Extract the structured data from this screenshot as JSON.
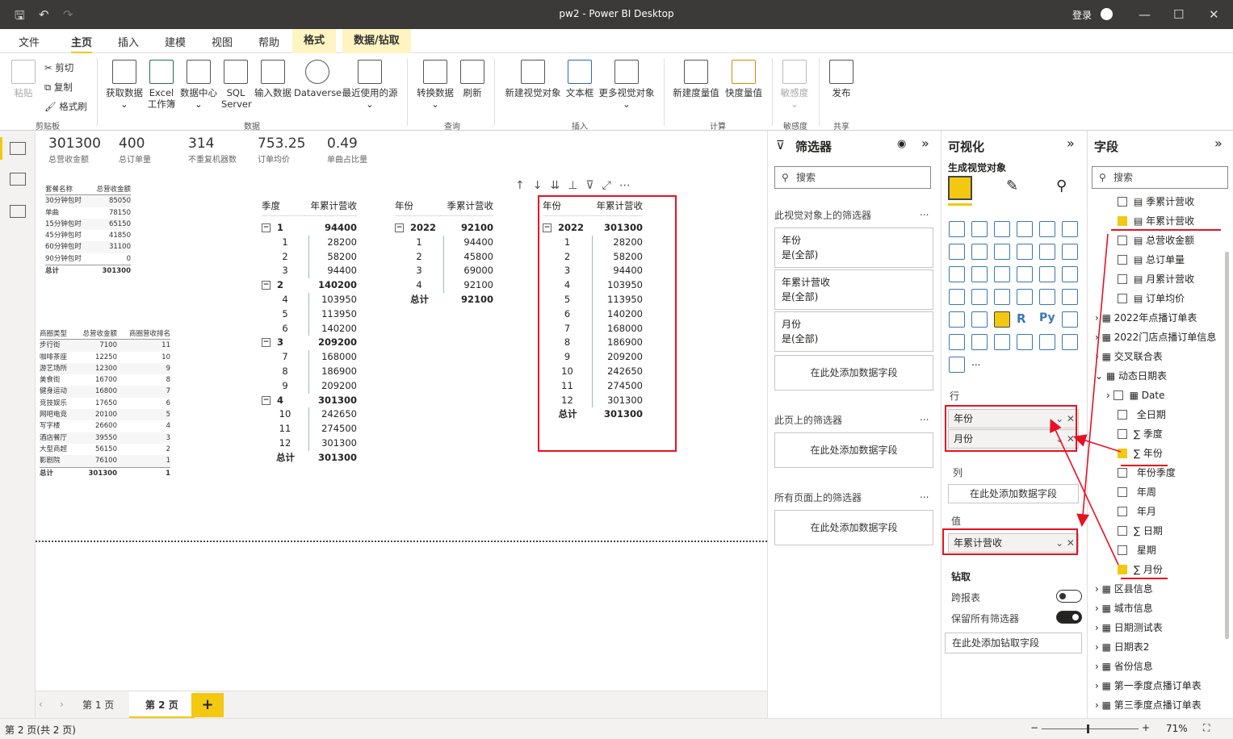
{
  "window": {
    "title": "pw2 - Power BI Desktop",
    "login": "登录"
  },
  "menu": [
    "文件",
    "主页",
    "插入",
    "建模",
    "视图",
    "帮助",
    "格式",
    "数据/钻取"
  ],
  "ribbon": {
    "clipboard": {
      "paste": "粘贴",
      "cut": "剪切",
      "copy": "复制",
      "format_painter": "格式刷",
      "group": "剪贴板"
    },
    "data": {
      "get_data": "获取数据",
      "excel": "Excel 工作簿",
      "datahub": "数据中心",
      "sql": "SQL Server",
      "enter": "输入数据",
      "dataverse": "Dataverse",
      "recent": "最近使用的源",
      "group": "数据"
    },
    "query": {
      "transform": "转换数据",
      "refresh": "刷新",
      "group": "查询"
    },
    "insert": {
      "new_visual": "新建视觉对象",
      "textbox": "文本框",
      "more_visuals": "更多视觉对象",
      "group": "插入"
    },
    "calc": {
      "new_measure": "新建度量值",
      "quick_measure": "快度量值",
      "group": "计算"
    },
    "sensitivity": {
      "label": "敏感度",
      "group": "敏感度"
    },
    "share": {
      "publish": "发布",
      "group": "共享"
    }
  },
  "kpis": [
    {
      "v": "301300",
      "l": "总营收金额"
    },
    {
      "v": "400",
      "l": "总订单量"
    },
    {
      "v": "314",
      "l": "不重复机器数"
    },
    {
      "v": "753.25",
      "l": "订单均价"
    },
    {
      "v": "0.49",
      "l": "单曲占比量"
    }
  ],
  "package_table": {
    "headers": [
      "套餐名称",
      "总营收金额"
    ],
    "rows": [
      [
        "30分钟包时",
        "85050"
      ],
      [
        "单曲",
        "78150"
      ],
      [
        "15分钟包时",
        "65150"
      ],
      [
        "45分钟包时",
        "41850"
      ],
      [
        "60分钟包时",
        "31100"
      ],
      [
        "90分钟包时",
        "0"
      ]
    ],
    "total": [
      "总计",
      "301300"
    ]
  },
  "business_table": {
    "headers": [
      "商圈类型",
      "总营收金额",
      "商圈营收排名"
    ],
    "rows": [
      [
        "步行街",
        "7100",
        "11"
      ],
      [
        "咖啡茶座",
        "12250",
        "10"
      ],
      [
        "游艺场所",
        "12300",
        "9"
      ],
      [
        "美食街",
        "16700",
        "8"
      ],
      [
        "健身运动",
        "16800",
        "7"
      ],
      [
        "竞技娱乐",
        "17650",
        "6"
      ],
      [
        "网吧电竞",
        "20100",
        "5"
      ],
      [
        "写字楼",
        "26600",
        "4"
      ],
      [
        "酒店餐厅",
        "39550",
        "3"
      ],
      [
        "大型商超",
        "56150",
        "2"
      ],
      [
        "影剧院",
        "76100",
        "1"
      ]
    ],
    "total": [
      "总计",
      "301300",
      "1"
    ]
  },
  "quarter_matrix": {
    "headers": [
      "季度",
      "年累计营收"
    ],
    "rows": [
      {
        "k": "1",
        "v": "94400",
        "lvl": 0
      },
      {
        "k": "1",
        "v": "28200",
        "lvl": 1
      },
      {
        "k": "2",
        "v": "58200",
        "lvl": 1
      },
      {
        "k": "3",
        "v": "94400",
        "lvl": 1
      },
      {
        "k": "2",
        "v": "140200",
        "lvl": 0
      },
      {
        "k": "4",
        "v": "103950",
        "lvl": 1
      },
      {
        "k": "5",
        "v": "113950",
        "lvl": 1
      },
      {
        "k": "6",
        "v": "140200",
        "lvl": 1
      },
      {
        "k": "3",
        "v": "209200",
        "lvl": 0
      },
      {
        "k": "7",
        "v": "168000",
        "lvl": 1
      },
      {
        "k": "8",
        "v": "186900",
        "lvl": 1
      },
      {
        "k": "9",
        "v": "209200",
        "lvl": 1
      },
      {
        "k": "4",
        "v": "301300",
        "lvl": 0
      },
      {
        "k": "10",
        "v": "242650",
        "lvl": 1
      },
      {
        "k": "11",
        "v": "274500",
        "lvl": 1
      },
      {
        "k": "12",
        "v": "301300",
        "lvl": 1
      },
      {
        "k": "总计",
        "v": "301300",
        "lvl": 2
      }
    ]
  },
  "year_quarter_matrix": {
    "headers": [
      "年份",
      "季累计营收"
    ],
    "rows": [
      {
        "k": "2022",
        "v": "92100",
        "lvl": 0
      },
      {
        "k": "1",
        "v": "94400",
        "lvl": 1
      },
      {
        "k": "2",
        "v": "45800",
        "lvl": 1
      },
      {
        "k": "3",
        "v": "69000",
        "lvl": 1
      },
      {
        "k": "4",
        "v": "92100",
        "lvl": 1
      },
      {
        "k": "总计",
        "v": "92100",
        "lvl": 2
      }
    ]
  },
  "year_month_matrix": {
    "headers": [
      "年份",
      "年累计营收"
    ],
    "rows": [
      {
        "k": "2022",
        "v": "301300",
        "lvl": 0
      },
      {
        "k": "1",
        "v": "28200",
        "lvl": 1
      },
      {
        "k": "2",
        "v": "58200",
        "lvl": 1
      },
      {
        "k": "3",
        "v": "94400",
        "lvl": 1
      },
      {
        "k": "4",
        "v": "103950",
        "lvl": 1
      },
      {
        "k": "5",
        "v": "113950",
        "lvl": 1
      },
      {
        "k": "6",
        "v": "140200",
        "lvl": 1
      },
      {
        "k": "7",
        "v": "168000",
        "lvl": 1
      },
      {
        "k": "8",
        "v": "186900",
        "lvl": 1
      },
      {
        "k": "9",
        "v": "209200",
        "lvl": 1
      },
      {
        "k": "10",
        "v": "242650",
        "lvl": 1
      },
      {
        "k": "11",
        "v": "274500",
        "lvl": 1
      },
      {
        "k": "12",
        "v": "301300",
        "lvl": 1
      },
      {
        "k": "总计",
        "v": "301300",
        "lvl": 2
      }
    ]
  },
  "pages": {
    "tabs": [
      "第 1 页",
      "第 2 页"
    ],
    "active": 1,
    "add": "+"
  },
  "status": {
    "page": "第 2 页(共 2 页)",
    "zoom": "71%"
  },
  "filters": {
    "title": "筛选器",
    "search": "搜索",
    "visual_section": "此视觉对象上的筛选器",
    "cards": [
      {
        "name": "年份",
        "value": "是(全部)"
      },
      {
        "name": "年累计营收",
        "value": "是(全部)"
      },
      {
        "name": "月份",
        "value": "是(全部)"
      }
    ],
    "add": "在此处添加数据字段",
    "page_section": "此页上的筛选器",
    "all_section": "所有页面上的筛选器",
    "more": "..."
  },
  "viz": {
    "title": "可视化",
    "subtitle": "生成视觉对象",
    "rows_label": "行",
    "rows": [
      "年份",
      "月份"
    ],
    "cols_label": "列",
    "cols_add": "在此处添加数据字段",
    "values_label": "值",
    "values": [
      "年累计营收"
    ],
    "drill": "钻取",
    "cross_report": "跨报表",
    "keep_filters": "保留所有筛选器",
    "drill_add": "在此处添加钻取字段",
    "r": "R",
    "py": "Py",
    "more": "..."
  },
  "fields": {
    "title": "字段",
    "search": "搜索",
    "items": [
      {
        "label": "季累计营收",
        "type": "cb",
        "checked": false,
        "indent": 1
      },
      {
        "label": "年累计营收",
        "type": "cb",
        "checked": true,
        "indent": 1
      },
      {
        "label": "总营收金额",
        "type": "cb",
        "checked": false,
        "indent": 1
      },
      {
        "label": "总订单量",
        "type": "cb",
        "checked": false,
        "indent": 1
      },
      {
        "label": "月累计营收",
        "type": "cb",
        "checked": false,
        "indent": 1
      },
      {
        "label": "订单均价",
        "type": "cb",
        "checked": false,
        "indent": 1
      },
      {
        "label": "2022年点播订单表",
        "type": "tbl",
        "indent": 0
      },
      {
        "label": "2022门店点播订单信息",
        "type": "tbl",
        "indent": 0
      },
      {
        "label": "交叉联合表",
        "type": "tbl",
        "indent": 0
      },
      {
        "label": "动态日期表",
        "type": "tbl",
        "indent": 0,
        "open": true
      },
      {
        "label": "Date",
        "type": "date",
        "indent": 1
      },
      {
        "label": "全日期",
        "type": "cb",
        "checked": false,
        "indent": 2
      },
      {
        "label": "季度",
        "type": "sum",
        "checked": false,
        "indent": 2
      },
      {
        "label": "年份",
        "type": "sum",
        "checked": true,
        "indent": 2
      },
      {
        "label": "年份季度",
        "type": "cb",
        "checked": false,
        "indent": 2
      },
      {
        "label": "年周",
        "type": "cb",
        "checked": false,
        "indent": 2
      },
      {
        "label": "年月",
        "type": "cb",
        "checked": false,
        "indent": 2
      },
      {
        "label": "日期",
        "type": "sum",
        "checked": false,
        "indent": 2
      },
      {
        "label": "星期",
        "type": "cb",
        "checked": false,
        "indent": 2
      },
      {
        "label": "月份",
        "type": "sum",
        "checked": true,
        "indent": 2
      },
      {
        "label": "区县信息",
        "type": "tbl",
        "indent": 0
      },
      {
        "label": "城市信息",
        "type": "tbl",
        "indent": 0
      },
      {
        "label": "日期测试表",
        "type": "tbl",
        "indent": 0
      },
      {
        "label": "日期表2",
        "type": "tbl",
        "indent": 0
      },
      {
        "label": "省份信息",
        "type": "tbl",
        "indent": 0
      },
      {
        "label": "第一季度点播订单表",
        "type": "tbl",
        "indent": 0
      },
      {
        "label": "第三季度点播订单表",
        "type": "tbl",
        "indent": 0
      }
    ]
  },
  "colors": {
    "accent": "#f2c811",
    "annotation": "#e81123",
    "titlebar": "#3b3a39"
  }
}
